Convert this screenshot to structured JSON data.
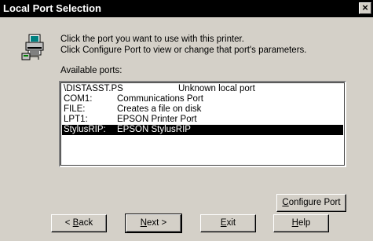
{
  "window": {
    "title": "Local Port Selection",
    "close_glyph": "×"
  },
  "instructions": [
    "Click the port you want to use with this printer.",
    "Click Configure Port to view or change that port's parameters."
  ],
  "available_label": "Available ports:",
  "ports": [
    {
      "port": "\\DISTASST.PS",
      "desc": "Unknown local port",
      "selected": false
    },
    {
      "port": "COM1:",
      "desc": "Communications Port",
      "selected": false
    },
    {
      "port": "FILE:",
      "desc": "Creates a file on disk",
      "selected": false
    },
    {
      "port": "LPT1:",
      "desc": "EPSON Printer Port",
      "selected": false
    },
    {
      "port": "StylusRIP:",
      "desc": "EPSON StylusRIP",
      "selected": true
    }
  ],
  "buttons": {
    "configure": {
      "mnemonic": "C",
      "rest": "onfigure Port"
    },
    "back": {
      "pre": "< ",
      "mnemonic": "B",
      "rest": "ack"
    },
    "next": {
      "mnemonic": "N",
      "rest": "ext >"
    },
    "exit": {
      "mnemonic": "E",
      "rest": "xit"
    },
    "help": {
      "mnemonic": "H",
      "rest": "elp"
    }
  },
  "icons": {
    "printer": "printer-port-icon"
  }
}
